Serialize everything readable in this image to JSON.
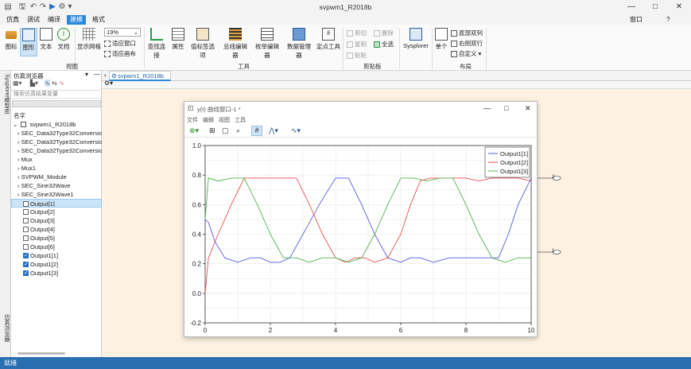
{
  "window": {
    "title": "svpwm1_R2018b",
    "controls": [
      "—",
      "□",
      "✕"
    ]
  },
  "menu_tabs": [
    "仿真",
    "调试",
    "编译",
    "建模",
    "格式"
  ],
  "menu_right": {
    "window_label": "窗口",
    "help": "?"
  },
  "ribbon": {
    "view_buttons": [
      "图标",
      "图形",
      "文本",
      "文档",
      "显示网格"
    ],
    "zoom": "19%",
    "fit_window": "适应窗口",
    "fit_canvas": "适应画布",
    "view_group": "视图",
    "tool_buttons": [
      "查找连接",
      "属性",
      "值标签选项",
      "总线编辑器",
      "枚举编辑器",
      "数据管理器",
      "定点工具"
    ],
    "tools_group": "工具",
    "clipboard": {
      "cut": "剪切",
      "copy": "复制",
      "paste": "粘贴",
      "delete": "删除",
      "select_all": "全选"
    },
    "clipboard_group": "剪贴板",
    "sysplorer": "Sysplorer",
    "single": "单个",
    "layout_items": [
      "底部双列",
      "右侧双行",
      "自定义"
    ],
    "layout_group": "布局"
  },
  "left_strip": {
    "top_label": "Sysplorer模型库",
    "bottom_label": "仿真浏览器"
  },
  "sim_browser": {
    "title": "仿真浏览器",
    "search_placeholder": "搜索仿真结果变量",
    "header": "名字",
    "root": "svpwm1_R2018b",
    "children": [
      "SEC_Data32Type32Conversion",
      "SEC_Data32Type32Conversion",
      "SEC_Data32Type32Conversion",
      "Mux",
      "Mux1",
      "SVPWM_Module",
      "SEC_Sine32Wave",
      "SEC_Sine32Wave1"
    ],
    "outputs": [
      {
        "label": "Output[1]",
        "checked": false,
        "selected": true
      },
      {
        "label": "Output[2]",
        "checked": false
      },
      {
        "label": "Output[3]",
        "checked": false
      },
      {
        "label": "Output[4]",
        "checked": false
      },
      {
        "label": "Output[5]",
        "checked": false
      },
      {
        "label": "Output[6]",
        "checked": false
      },
      {
        "label": "Output1[1]",
        "checked": true
      },
      {
        "label": "Output1[2]",
        "checked": true
      },
      {
        "label": "Output1[3]",
        "checked": true
      }
    ]
  },
  "doc_tab": "svpwm1_R2018b",
  "status": "就绪",
  "plot_window": {
    "title": "y(t) 曲线窗口-1 *",
    "menu": [
      "文件",
      "编辑",
      "视图",
      "工具"
    ]
  },
  "canvas_ports": [
    "2",
    "1"
  ],
  "chart_data": {
    "type": "line",
    "xlim": [
      0,
      10
    ],
    "ylim": [
      -0.2,
      1.0
    ],
    "x_ticks": [
      0,
      2,
      4,
      6,
      8,
      10
    ],
    "y_ticks": [
      -0.2,
      0.0,
      0.2,
      0.4,
      0.6,
      0.8,
      1.0
    ],
    "grid": true,
    "legend_position": "top-right",
    "series": [
      {
        "name": "Output1[1]",
        "color": "#5a5ae6",
        "x": [
          0,
          0.1,
          0.3,
          0.6,
          1.0,
          1.4,
          1.7,
          2.0,
          2.3,
          2.6,
          3.0,
          3.5,
          4.0,
          4.4,
          4.8,
          5.2,
          5.6,
          6.0,
          6.3,
          6.6,
          7.0,
          7.5,
          8.0,
          8.5,
          8.8,
          9.0,
          9.3,
          9.6,
          10.0
        ],
        "y": [
          0.5,
          0.48,
          0.35,
          0.24,
          0.21,
          0.24,
          0.24,
          0.21,
          0.21,
          0.24,
          0.4,
          0.6,
          0.78,
          0.78,
          0.6,
          0.4,
          0.24,
          0.21,
          0.24,
          0.24,
          0.21,
          0.24,
          0.24,
          0.24,
          0.24,
          0.24,
          0.4,
          0.6,
          0.78
        ]
      },
      {
        "name": "Output1[2]",
        "color": "#e65050",
        "x": [
          0,
          0.1,
          0.4,
          0.8,
          1.2,
          1.6,
          2.0,
          2.4,
          2.8,
          3.2,
          3.6,
          4.0,
          4.3,
          4.6,
          4.9,
          5.2,
          5.6,
          6.0,
          6.3,
          6.6,
          6.9,
          7.2,
          7.6,
          8.0,
          8.4,
          8.8,
          9.2,
          9.6,
          10.0
        ],
        "y": [
          0.0,
          0.24,
          0.4,
          0.6,
          0.78,
          0.78,
          0.78,
          0.78,
          0.78,
          0.6,
          0.4,
          0.24,
          0.21,
          0.24,
          0.24,
          0.21,
          0.24,
          0.4,
          0.6,
          0.76,
          0.78,
          0.78,
          0.78,
          0.78,
          0.76,
          0.78,
          0.78,
          0.78,
          0.76
        ]
      },
      {
        "name": "Output1[3]",
        "color": "#50b450",
        "x": [
          0,
          0.1,
          0.4,
          0.8,
          1.2,
          1.6,
          2.0,
          2.4,
          2.8,
          3.2,
          3.6,
          4.0,
          4.4,
          4.8,
          5.2,
          5.6,
          6.0,
          6.4,
          6.8,
          7.2,
          7.6,
          8.0,
          8.4,
          8.8,
          9.2,
          9.6,
          10.0
        ],
        "y": [
          0.5,
          0.78,
          0.76,
          0.78,
          0.78,
          0.6,
          0.4,
          0.24,
          0.24,
          0.21,
          0.24,
          0.24,
          0.21,
          0.24,
          0.4,
          0.6,
          0.78,
          0.78,
          0.76,
          0.78,
          0.78,
          0.6,
          0.4,
          0.24,
          0.21,
          0.24,
          0.24
        ]
      }
    ]
  }
}
